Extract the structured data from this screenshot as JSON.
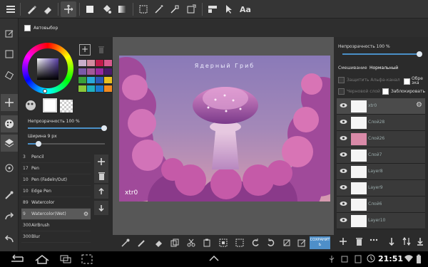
{
  "options": {
    "autoselect_label": "Автовыбор"
  },
  "color_panel": {
    "opacity_label": "Непрозрачность 100 %",
    "opacity_value": 1.0,
    "width_label": "Ширина 9 px",
    "width_fraction": 0.12,
    "swatches": [
      "#c8aecb",
      "#d28ca0",
      "#c01a4a",
      "#d95a8e",
      "#7a5aa8",
      "#a35a98",
      "#9a2aa0",
      "#4a1a6a",
      "#3aa03a",
      "#2aa8d8",
      "#2a5ab8",
      "#e8c020",
      "#8ac83a",
      "#20b0c0",
      "#1a7ad0",
      "#f08a20"
    ]
  },
  "brushes": [
    {
      "size": "3",
      "name": "Pencil"
    },
    {
      "size": "17",
      "name": "Pen"
    },
    {
      "size": "10",
      "name": "Pen (Fadeln/Out)"
    },
    {
      "size": "10",
      "name": "Edge Pen"
    },
    {
      "size": "89",
      "name": "Watercolor"
    },
    {
      "size": "9",
      "name": "Watercolor(Wet)"
    },
    {
      "size": "300",
      "name": "AirBrush"
    },
    {
      "size": "300",
      "name": "Blur"
    }
  ],
  "artwork": {
    "title": "Ядерный Гриб",
    "signature": "xtr0"
  },
  "bottom_toolbar": {
    "save_label": "СОХРАНИТЬ"
  },
  "layers_panel": {
    "opacity_label": "Непрозрачность 100 %",
    "opacity_value": 1.0,
    "blend_label": "Смешивание",
    "blend_value": "Нормальный",
    "protect_alpha_label": "Защитить Альфа-канал",
    "clip_label": "Обре зка",
    "draft_label": "Черновой слой",
    "lock_label": "Заблокировать",
    "layers": [
      {
        "name": "xtr0"
      },
      {
        "name": "Слой28"
      },
      {
        "name": "Слой26"
      },
      {
        "name": "Слой7"
      },
      {
        "name": "Layer8"
      },
      {
        "name": "Layer9"
      },
      {
        "name": "Слой6"
      },
      {
        "name": "Layer10"
      }
    ]
  },
  "status_bar": {
    "time": "21:51"
  }
}
